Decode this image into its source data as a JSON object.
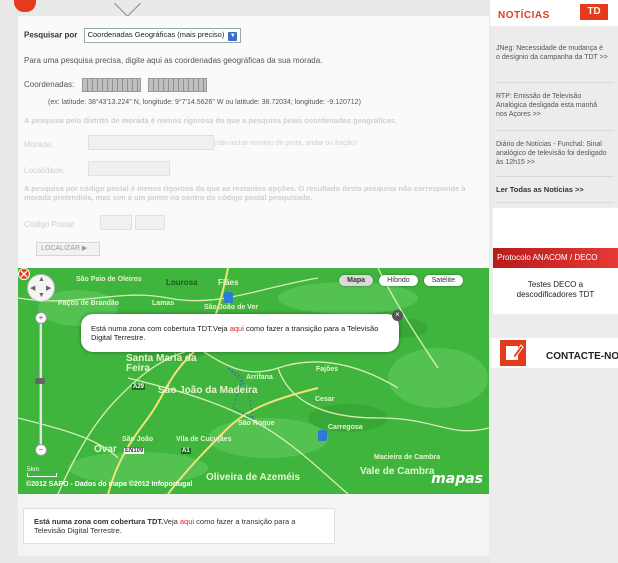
{
  "colors": {
    "accent": "#e43b1f",
    "map_green": "#3fb53d",
    "link_red": "#d22222"
  },
  "header": {
    "icon": "chevron-down-icon"
  },
  "search": {
    "label": "Pesquisar por",
    "select_value": "Coordenadas Geográficas (mais preciso)",
    "instruction": "Para uma pesquisa precisa, digite aqui as coordenadas geográficas da sua morada.",
    "coords_label": "Coordenadas:",
    "example": "(ex: latitude: 38°43'13.224'' N, longitude: 9°7'14.5626'' W ou latitude: 38.72034; longitude: -9.120712)",
    "address_note": "A pesquisa pelo distrito de morada é menos rigorosa do que a pesquisa pelas coordenadas geográficas.",
    "morada_label": "Morada:",
    "morada_hint": "(não incluir número de porta, andar ou fração)",
    "localidade_label": "Localidade:",
    "postal_note": "A pesquisa por código postal é menos rigorosa do que as restantes opções. O resultado desta pesquisa não corresponde à morada pretendida, mas sim a um ponto no centro do código postal pesquisado.",
    "postal_label": "Código Postal:",
    "button_label": "LOCALIZAR  ▶"
  },
  "map": {
    "types": [
      "Mapa",
      "Híbrido",
      "Satélite"
    ],
    "active_type": "Mapa",
    "popup_text_before": "Está numa zona com cobertura TDT.Veja ",
    "popup_link": "aqui",
    "popup_text_after": " como fazer a transição para a Televisão Digital Terrestre.",
    "scale": "5km",
    "copyright": "©2012 SAPO - Dados do mapa ©2012 Infoportugal",
    "brand": "mapas",
    "places": {
      "lourosa": "Lourosa",
      "fiaes": "Fiães",
      "santa_maria": "Santa Maria da Feira",
      "arrifana": "Arrifana",
      "sao_joao": "São João da Madeira",
      "ovar": "Ovar",
      "oliveira": "Oliveira de Azeméis",
      "vale_cambra": "Vale de Cambra",
      "fajoes": "Fajões",
      "cesar": "Cesar",
      "cucujaes": "Vila de Cucujães",
      "sao_roque": "São Roque",
      "carregosa": "Carregosa",
      "macieira": "Macieira de Cambra",
      "paco_brandao": "Paços de Brandão",
      "lamas": "Lamas",
      "sao_joao_ver": "São João de Ver",
      "esmoriz": "São Paio de Oleiros",
      "sao_joao_ovar": "São João",
      "roads": {
        "a29": "A29",
        "en109": "EN109",
        "a1": "A1"
      }
    }
  },
  "info": {
    "bold": "Está numa zona com cobertura TDT.",
    "text_before": "Veja ",
    "link": "aqui",
    "text_after": " como fazer a transição para a Televisão Digital Terrestre."
  },
  "sidebar": {
    "title": "NOTÍCIAS",
    "logo_text": "TD",
    "news": [
      "JNeg: Necessidade de mudança é o desígnio da campanha da TDT >>",
      "RTP: Emissão de Televisão Analógica desligada esta manhã nos Açores >>",
      "Diário de Notícias - Funchal: Sinal analógico de televisão foi desligado às 12h15 >>"
    ],
    "read_all": "Ler Todas as Notícias >>",
    "banner_title": "Protocolo ANACOM / DECO",
    "banner_text": "Testes DECO a descodificadores TDT",
    "contact": "CONTACTE-NO"
  }
}
